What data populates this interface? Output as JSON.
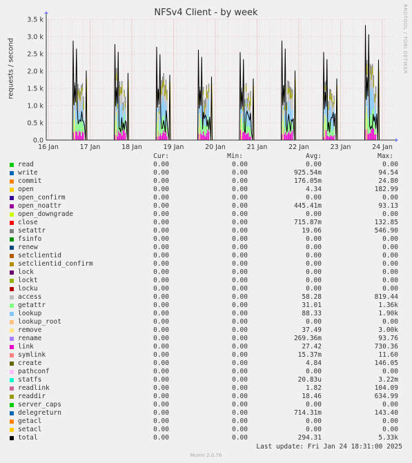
{
  "chart_data": {
    "type": "area",
    "title": "NFSv4 Client - by week",
    "ylabel": "requests / second",
    "ylim": [
      0,
      3500
    ],
    "yticks": [
      "0.0",
      "0.5 k",
      "1.0 k",
      "1.5 k",
      "2.0 k",
      "2.5 k",
      "3.0 k",
      "3.5 k"
    ],
    "xticks": [
      "16 Jan",
      "17 Jan",
      "18 Jan",
      "19 Jan",
      "20 Jan",
      "21 Jan",
      "22 Jan",
      "23 Jan",
      "24 Jan"
    ],
    "grid": true,
    "series_total_peaks": [
      {
        "day": "16 Jan",
        "peak": 2880
      },
      {
        "day": "17 Jan",
        "peak": 2780
      },
      {
        "day": "18 Jan",
        "peak": 2700
      },
      {
        "day": "19 Jan",
        "peak": 2620
      },
      {
        "day": "20 Jan",
        "peak": 2550
      },
      {
        "day": "21 Jan",
        "peak": 2880
      },
      {
        "day": "22 Jan",
        "peak": 2550
      },
      {
        "day": "23 Jan",
        "peak": 3330
      }
    ]
  },
  "watermark": "RRDTOOL / TOBI OETIKER",
  "legend_headers": {
    "cur": "Cur:",
    "min": "Min:",
    "avg": "Avg:",
    "max": "Max:"
  },
  "legend": [
    {
      "name": "read",
      "color": "#00cc00",
      "cur": "0.00",
      "min": "0.00",
      "avg": "0.00",
      "max": "0.00"
    },
    {
      "name": "write",
      "color": "#0066b3",
      "cur": "0.00",
      "min": "0.00",
      "avg": "925.54m",
      "max": "94.54"
    },
    {
      "name": "commit",
      "color": "#ff8000",
      "cur": "0.00",
      "min": "0.00",
      "avg": "176.05m",
      "max": "24.80"
    },
    {
      "name": "open",
      "color": "#ffcc00",
      "cur": "0.00",
      "min": "0.00",
      "avg": "4.34",
      "max": "182.99"
    },
    {
      "name": "open_confirm",
      "color": "#330099",
      "cur": "0.00",
      "min": "0.00",
      "avg": "0.00",
      "max": "0.00"
    },
    {
      "name": "open_noattr",
      "color": "#990099",
      "cur": "0.00",
      "min": "0.00",
      "avg": "445.41m",
      "max": "93.13"
    },
    {
      "name": "open_downgrade",
      "color": "#ccff00",
      "cur": "0.00",
      "min": "0.00",
      "avg": "0.00",
      "max": "0.00"
    },
    {
      "name": "close",
      "color": "#ff0000",
      "cur": "0.00",
      "min": "0.00",
      "avg": "715.87m",
      "max": "132.85"
    },
    {
      "name": "setattr",
      "color": "#808080",
      "cur": "0.00",
      "min": "0.00",
      "avg": "19.06",
      "max": "546.90"
    },
    {
      "name": "fsinfo",
      "color": "#008f00",
      "cur": "0.00",
      "min": "0.00",
      "avg": "0.00",
      "max": "0.00"
    },
    {
      "name": "renew",
      "color": "#00487d",
      "cur": "0.00",
      "min": "0.00",
      "avg": "0.00",
      "max": "0.00"
    },
    {
      "name": "setclientid",
      "color": "#b35a00",
      "cur": "0.00",
      "min": "0.00",
      "avg": "0.00",
      "max": "0.00"
    },
    {
      "name": "setclientid_confirm",
      "color": "#b38f00",
      "cur": "0.00",
      "min": "0.00",
      "avg": "0.00",
      "max": "0.00"
    },
    {
      "name": "lock",
      "color": "#6b006b",
      "cur": "0.00",
      "min": "0.00",
      "avg": "0.00",
      "max": "0.00"
    },
    {
      "name": "lockt",
      "color": "#8fb300",
      "cur": "0.00",
      "min": "0.00",
      "avg": "0.00",
      "max": "0.00"
    },
    {
      "name": "locku",
      "color": "#b30000",
      "cur": "0.00",
      "min": "0.00",
      "avg": "0.00",
      "max": "0.00"
    },
    {
      "name": "access",
      "color": "#bebebe",
      "cur": "0.00",
      "min": "0.00",
      "avg": "58.28",
      "max": "819.44"
    },
    {
      "name": "getattr",
      "color": "#80ff80",
      "cur": "0.00",
      "min": "0.00",
      "avg": "31.01",
      "max": "1.36k"
    },
    {
      "name": "lookup",
      "color": "#80c9ff",
      "cur": "0.00",
      "min": "0.00",
      "avg": "88.33",
      "max": "1.90k"
    },
    {
      "name": "lookup_root",
      "color": "#ffc080",
      "cur": "0.00",
      "min": "0.00",
      "avg": "0.00",
      "max": "0.00"
    },
    {
      "name": "remove",
      "color": "#ffe680",
      "cur": "0.00",
      "min": "0.00",
      "avg": "37.49",
      "max": "3.00k"
    },
    {
      "name": "rename",
      "color": "#aa80ff",
      "cur": "0.00",
      "min": "0.00",
      "avg": "269.36m",
      "max": "93.76"
    },
    {
      "name": "link",
      "color": "#ee00cc",
      "cur": "0.00",
      "min": "0.00",
      "avg": "27.42",
      "max": "730.36"
    },
    {
      "name": "symlink",
      "color": "#ff8080",
      "cur": "0.00",
      "min": "0.00",
      "avg": "15.37m",
      "max": "11.60"
    },
    {
      "name": "create",
      "color": "#666600",
      "cur": "0.00",
      "min": "0.00",
      "avg": "4.84",
      "max": "146.05"
    },
    {
      "name": "pathconf",
      "color": "#ffbfff",
      "cur": "0.00",
      "min": "0.00",
      "avg": "0.00",
      "max": "0.00"
    },
    {
      "name": "statfs",
      "color": "#00ffcc",
      "cur": "0.00",
      "min": "0.00",
      "avg": "20.83u",
      "max": "3.22m"
    },
    {
      "name": "readlink",
      "color": "#cc6699",
      "cur": "0.00",
      "min": "0.00",
      "avg": "1.82",
      "max": "104.09"
    },
    {
      "name": "readdir",
      "color": "#999900",
      "cur": "0.00",
      "min": "0.00",
      "avg": "18.46",
      "max": "634.99"
    },
    {
      "name": "server_caps",
      "color": "#00cc00",
      "cur": "0.00",
      "min": "0.00",
      "avg": "0.00",
      "max": "0.00"
    },
    {
      "name": "delegreturn",
      "color": "#0066b3",
      "cur": "0.00",
      "min": "0.00",
      "avg": "714.31m",
      "max": "143.40"
    },
    {
      "name": "getacl",
      "color": "#ff8000",
      "cur": "0.00",
      "min": "0.00",
      "avg": "0.00",
      "max": "0.00"
    },
    {
      "name": "setacl",
      "color": "#ffcc00",
      "cur": "0.00",
      "min": "0.00",
      "avg": "0.00",
      "max": "0.00"
    },
    {
      "name": "total",
      "color": "#000000",
      "cur": "0.00",
      "min": "0.00",
      "avg": "294.31",
      "max": "5.33k"
    }
  ],
  "last_update": "Last update: Fri Jan 24 18:31:00 2025",
  "footer": "Munin 2.0.76"
}
